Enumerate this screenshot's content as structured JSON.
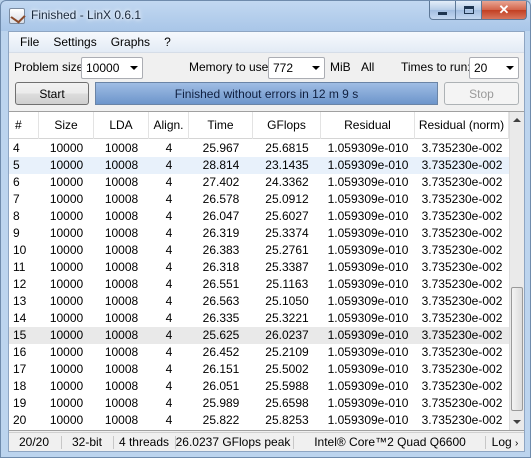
{
  "window": {
    "title": "Finished - LinX 0.6.1"
  },
  "menu": [
    "File",
    "Settings",
    "Graphs",
    "?"
  ],
  "controls": {
    "problem_size_label": "Problem size:",
    "problem_size_value": "10000",
    "memory_label": "Memory to use:",
    "memory_value": "772",
    "memory_unit": "MiB",
    "memory_all": "All",
    "times_label": "Times to run:",
    "times_value": "20"
  },
  "actions": {
    "start_label": "Start",
    "status_text": "Finished without errors in 12 m 9 s",
    "status_progress": 1.0,
    "stop_label": "Stop"
  },
  "table": {
    "columns": [
      "#",
      "Size",
      "LDA",
      "Align.",
      "Time",
      "GFlops",
      "Residual",
      "Residual (norm)"
    ],
    "rows": [
      [
        "4",
        "10000",
        "10008",
        "4",
        "25.967",
        "25.6815",
        "1.059309e-010",
        "3.735230e-002"
      ],
      [
        "5",
        "10000",
        "10008",
        "4",
        "28.814",
        "23.1435",
        "1.059309e-010",
        "3.735230e-002"
      ],
      [
        "6",
        "10000",
        "10008",
        "4",
        "27.402",
        "24.3362",
        "1.059309e-010",
        "3.735230e-002"
      ],
      [
        "7",
        "10000",
        "10008",
        "4",
        "26.578",
        "25.0912",
        "1.059309e-010",
        "3.735230e-002"
      ],
      [
        "8",
        "10000",
        "10008",
        "4",
        "26.047",
        "25.6027",
        "1.059309e-010",
        "3.735230e-002"
      ],
      [
        "9",
        "10000",
        "10008",
        "4",
        "26.319",
        "25.3374",
        "1.059309e-010",
        "3.735230e-002"
      ],
      [
        "10",
        "10000",
        "10008",
        "4",
        "26.383",
        "25.2761",
        "1.059309e-010",
        "3.735230e-002"
      ],
      [
        "11",
        "10000",
        "10008",
        "4",
        "26.318",
        "25.3387",
        "1.059309e-010",
        "3.735230e-002"
      ],
      [
        "12",
        "10000",
        "10008",
        "4",
        "26.551",
        "25.1163",
        "1.059309e-010",
        "3.735230e-002"
      ],
      [
        "13",
        "10000",
        "10008",
        "4",
        "26.563",
        "25.1050",
        "1.059309e-010",
        "3.735230e-002"
      ],
      [
        "14",
        "10000",
        "10008",
        "4",
        "26.335",
        "25.3221",
        "1.059309e-010",
        "3.735230e-002"
      ],
      [
        "15",
        "10000",
        "10008",
        "4",
        "25.625",
        "26.0237",
        "1.059309e-010",
        "3.735230e-002"
      ],
      [
        "16",
        "10000",
        "10008",
        "4",
        "26.452",
        "25.2109",
        "1.059309e-010",
        "3.735230e-002"
      ],
      [
        "17",
        "10000",
        "10008",
        "4",
        "26.151",
        "25.5002",
        "1.059309e-010",
        "3.735230e-002"
      ],
      [
        "18",
        "10000",
        "10008",
        "4",
        "26.051",
        "25.5988",
        "1.059309e-010",
        "3.735230e-002"
      ],
      [
        "19",
        "10000",
        "10008",
        "4",
        "25.989",
        "25.6598",
        "1.059309e-010",
        "3.735230e-002"
      ],
      [
        "20",
        "10000",
        "10008",
        "4",
        "25.822",
        "25.8253",
        "1.059309e-010",
        "3.735230e-002"
      ]
    ]
  },
  "statusbar": {
    "progress": "20/20",
    "bits": "32-bit",
    "threads": "4 threads",
    "peak": "26.0237 GFlops peak",
    "cpu": "Intel® Core™2 Quad Q6600",
    "log": "Log"
  },
  "colors": {
    "titlebar": "#a9c6e8",
    "status_fill": "#82a5d4",
    "row_selected": "#e8f1fb",
    "row_peak": "#e9e9e9"
  }
}
